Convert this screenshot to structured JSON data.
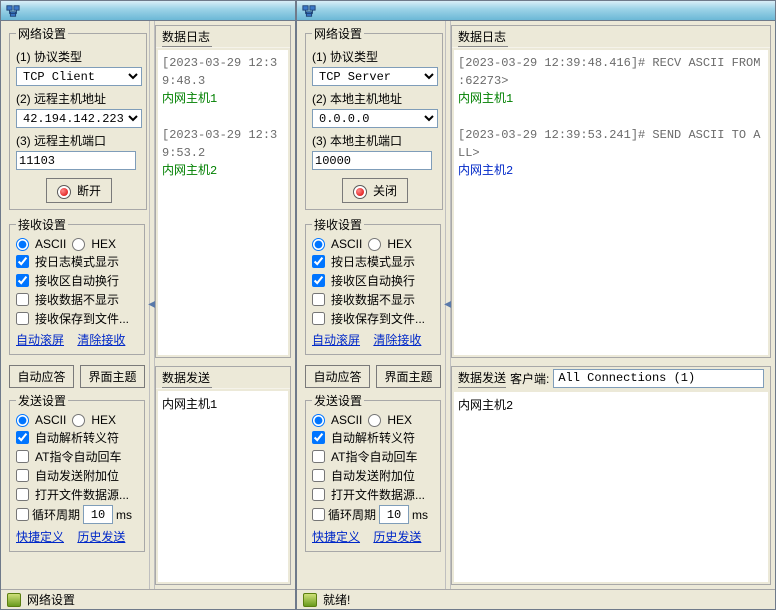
{
  "left": {
    "network": {
      "legend": "网络设置",
      "proto_label": "(1) 协议类型",
      "proto_value": "TCP Client",
      "host_label": "(2) 远程主机地址",
      "host_value": "42.194.142.223",
      "port_label": "(3) 远程主机端口",
      "port_value": "11103",
      "main_btn": "断开"
    },
    "recv": {
      "legend": "接收设置",
      "ascii": "ASCII",
      "hex": "HEX",
      "opt1": "按日志模式显示",
      "opt2": "接收区自动换行",
      "opt3": "接收数据不显示",
      "opt4": "接收保存到文件...",
      "link1": "自动滚屏",
      "link2": "清除接收"
    },
    "mid_btn1": "自动应答",
    "mid_btn2": "界面主题",
    "send": {
      "legend": "发送设置",
      "ascii": "ASCII",
      "hex": "HEX",
      "opt1": "自动解析转义符",
      "opt2": "AT指令自动回车",
      "opt3": "自动发送附加位",
      "opt4": "打开文件数据源...",
      "cycle_label": "循环周期",
      "cycle_value": "10",
      "cycle_unit": "ms",
      "link1": "快捷定义",
      "link2": "历史发送"
    },
    "log_title": "数据日志",
    "log_lines": [
      {
        "cls": "gray",
        "text": "[2023-03-29 12:39:48.3"
      },
      {
        "cls": "green",
        "text": "内网主机1"
      },
      {
        "cls": "",
        "text": ""
      },
      {
        "cls": "gray",
        "text": "[2023-03-29 12:39:53.2"
      },
      {
        "cls": "green",
        "text": "内网主机2"
      }
    ],
    "send_title": "数据发送",
    "send_body": "内网主机1",
    "status": "网络设置"
  },
  "right": {
    "network": {
      "legend": "网络设置",
      "proto_label": "(1) 协议类型",
      "proto_value": "TCP Server",
      "host_label": "(2) 本地主机地址",
      "host_value": "0.0.0.0",
      "port_label": "(3) 本地主机端口",
      "port_value": "10000",
      "main_btn": "关闭"
    },
    "recv": {
      "legend": "接收设置",
      "ascii": "ASCII",
      "hex": "HEX",
      "opt1": "按日志模式显示",
      "opt2": "接收区自动换行",
      "opt3": "接收数据不显示",
      "opt4": "接收保存到文件...",
      "link1": "自动滚屏",
      "link2": "清除接收"
    },
    "mid_btn1": "自动应答",
    "mid_btn2": "界面主题",
    "send": {
      "legend": "发送设置",
      "ascii": "ASCII",
      "hex": "HEX",
      "opt1": "自动解析转义符",
      "opt2": "AT指令自动回车",
      "opt3": "自动发送附加位",
      "opt4": "打开文件数据源...",
      "cycle_label": "循环周期",
      "cycle_value": "10",
      "cycle_unit": "ms",
      "link1": "快捷定义",
      "link2": "历史发送"
    },
    "log_title": "数据日志",
    "log_lines": [
      {
        "cls": "gray",
        "text": "[2023-03-29 12:39:48.416]# RECV ASCII FROM  :62273>"
      },
      {
        "cls": "green",
        "text": "内网主机1"
      },
      {
        "cls": "",
        "text": ""
      },
      {
        "cls": "gray",
        "text": "[2023-03-29 12:39:53.241]# SEND ASCII TO ALL>"
      },
      {
        "cls": "blue",
        "text": "内网主机2"
      }
    ],
    "send_title": "数据发送",
    "client_label": "客户端:",
    "conn_value": "All Connections (1)",
    "send_body": "内网主机2",
    "status": "就绪!"
  }
}
